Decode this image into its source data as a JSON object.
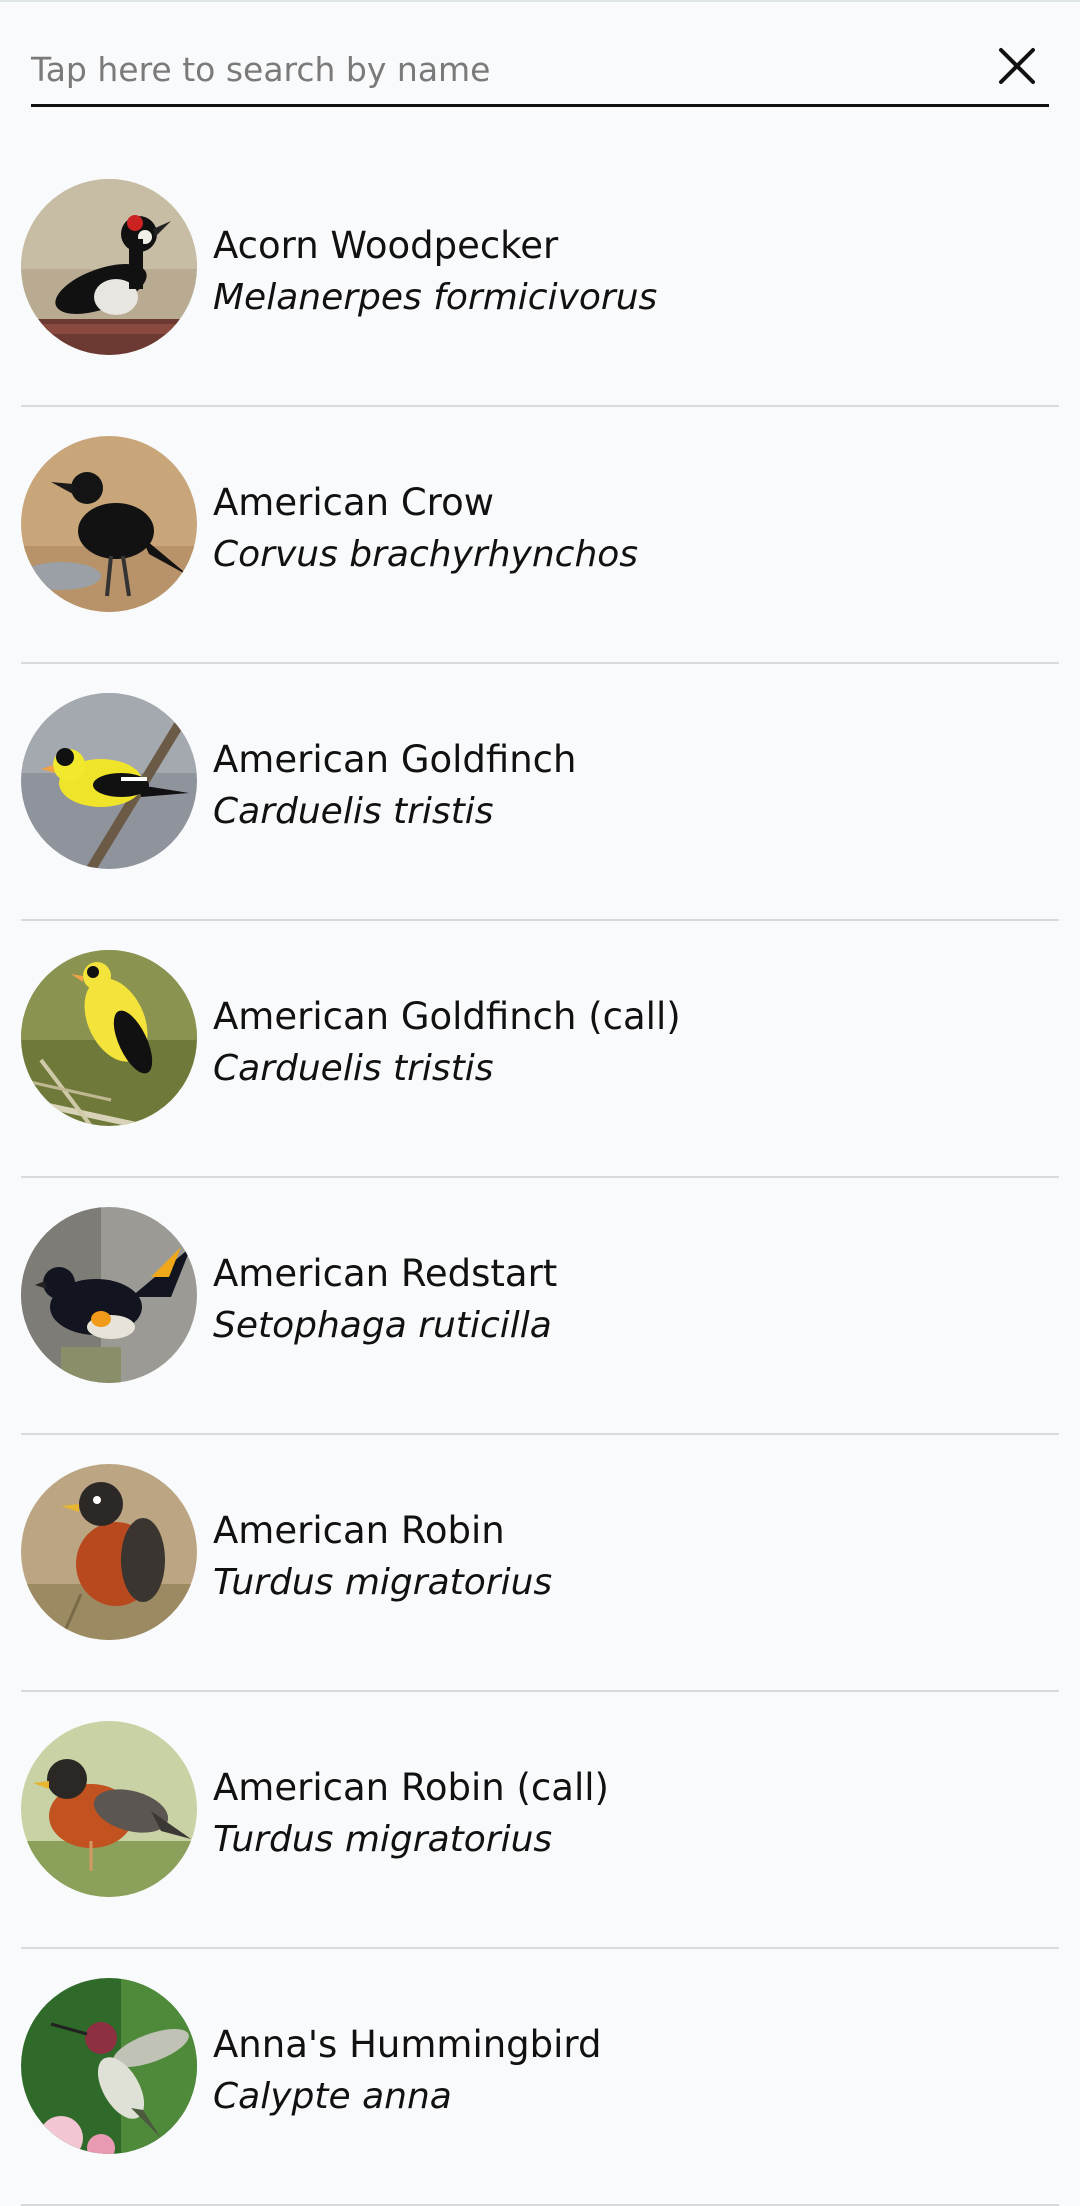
{
  "search": {
    "placeholder": "Tap here to search by name",
    "value": ""
  },
  "birds": [
    {
      "common": "Acorn Woodpecker",
      "scientific": "Melanerpes formicivorus",
      "icon": "acorn-woodpecker-photo"
    },
    {
      "common": "American Crow",
      "scientific": "Corvus brachyrhynchos",
      "icon": "american-crow-photo"
    },
    {
      "common": "American Goldfinch",
      "scientific": "Carduelis tristis",
      "icon": "american-goldfinch-photo"
    },
    {
      "common": "American Goldfinch (call)",
      "scientific": "Carduelis tristis",
      "icon": "american-goldfinch-call-photo"
    },
    {
      "common": "American Redstart",
      "scientific": "Setophaga ruticilla",
      "icon": "american-redstart-photo"
    },
    {
      "common": "American Robin",
      "scientific": "Turdus migratorius",
      "icon": "american-robin-photo"
    },
    {
      "common": "American Robin (call)",
      "scientific": "Turdus migratorius",
      "icon": "american-robin-call-photo"
    },
    {
      "common": "Anna's Hummingbird",
      "scientific": "Calypte anna",
      "icon": "annas-hummingbird-photo"
    }
  ]
}
